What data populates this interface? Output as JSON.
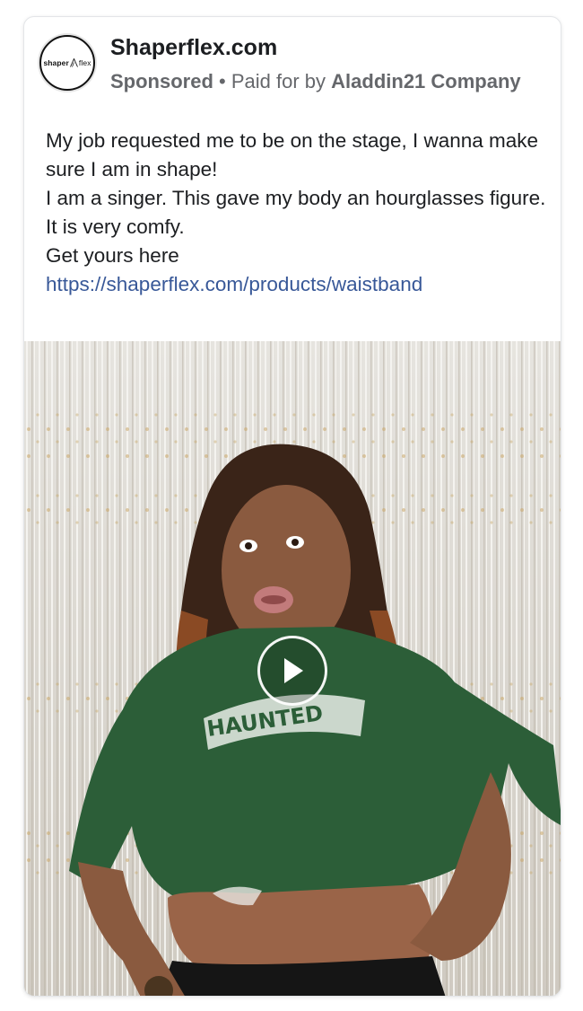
{
  "advertiser": {
    "page_name": "Shaperflex.com",
    "sponsored_label": "Sponsored",
    "separator": "•",
    "paid_for_prefix": "Paid for by",
    "paid_for_company": "Aladdin21 Company",
    "avatar_logo_left": "shaper",
    "avatar_logo_right": "flex"
  },
  "post": {
    "lines": [
      "My job requested me to be on the stage, I wanna make sure I am in shape!",
      "I am a singer. This gave my body an hourglasses figure.",
      "It is very comfy.",
      "Get yours here"
    ],
    "link_text": "https://shaperflex.com/products/waistband",
    "link_color": "#385898"
  },
  "video": {
    "play_icon": "play-icon",
    "shirt_text": "HAUNTED"
  }
}
